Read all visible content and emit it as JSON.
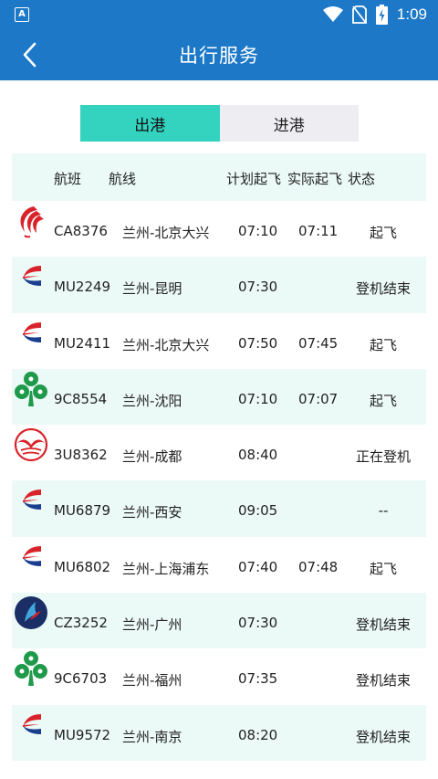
{
  "status_bar": {
    "time": "1:09",
    "app_icon_letter": "A",
    "icons": [
      "wifi-icon",
      "no-sim-icon",
      "battery-charging-icon"
    ]
  },
  "nav": {
    "title": "出行服务",
    "back_icon": "chevron-left-icon"
  },
  "tabs": [
    {
      "label": "出港",
      "active": true
    },
    {
      "label": "进港",
      "active": false
    }
  ],
  "table": {
    "headers": {
      "flight": "航班",
      "route": "航线",
      "planned": "计划起飞",
      "actual": "实际起飞",
      "status": "状态"
    },
    "rows": [
      {
        "logo": "air-china-logo",
        "flight": "CA8376",
        "route": "兰州-北京大兴",
        "planned": "07:10",
        "actual": "07:11",
        "status": "起飞"
      },
      {
        "logo": "china-eastern-logo",
        "flight": "MU2249",
        "route": "兰州-昆明",
        "planned": "07:30",
        "actual": "",
        "status": "登机结束"
      },
      {
        "logo": "china-eastern-logo",
        "flight": "MU2411",
        "route": "兰州-北京大兴",
        "planned": "07:50",
        "actual": "07:45",
        "status": "起飞"
      },
      {
        "logo": "spring-airlines-logo",
        "flight": "9C8554",
        "route": "兰州-沈阳",
        "planned": "07:10",
        "actual": "07:07",
        "status": "起飞"
      },
      {
        "logo": "sichuan-airlines-logo",
        "flight": "3U8362",
        "route": "兰州-成都",
        "planned": "08:40",
        "actual": "",
        "status": "正在登机"
      },
      {
        "logo": "china-eastern-logo",
        "flight": "MU6879",
        "route": "兰州-西安",
        "planned": "09:05",
        "actual": "",
        "status": "--"
      },
      {
        "logo": "china-eastern-logo",
        "flight": "MU6802",
        "route": "兰州-上海浦东",
        "planned": "07:40",
        "actual": "07:48",
        "status": "起飞"
      },
      {
        "logo": "china-southern-logo",
        "flight": "CZ3252",
        "route": "兰州-广州",
        "planned": "07:30",
        "actual": "",
        "status": "登机结束"
      },
      {
        "logo": "spring-airlines-logo",
        "flight": "9C6703",
        "route": "兰州-福州",
        "planned": "07:35",
        "actual": "",
        "status": "登机结束"
      },
      {
        "logo": "china-eastern-logo",
        "flight": "MU9572",
        "route": "兰州-南京",
        "planned": "08:20",
        "actual": "",
        "status": "登机结束"
      }
    ]
  },
  "colors": {
    "brand_blue": "#1d79c8",
    "tab_active": "#33d3c0",
    "row_alt": "#ecfaf7",
    "eastern_red": "#d8232a",
    "eastern_blue": "#1b3f8f",
    "spring_green": "#1f9a4a"
  }
}
